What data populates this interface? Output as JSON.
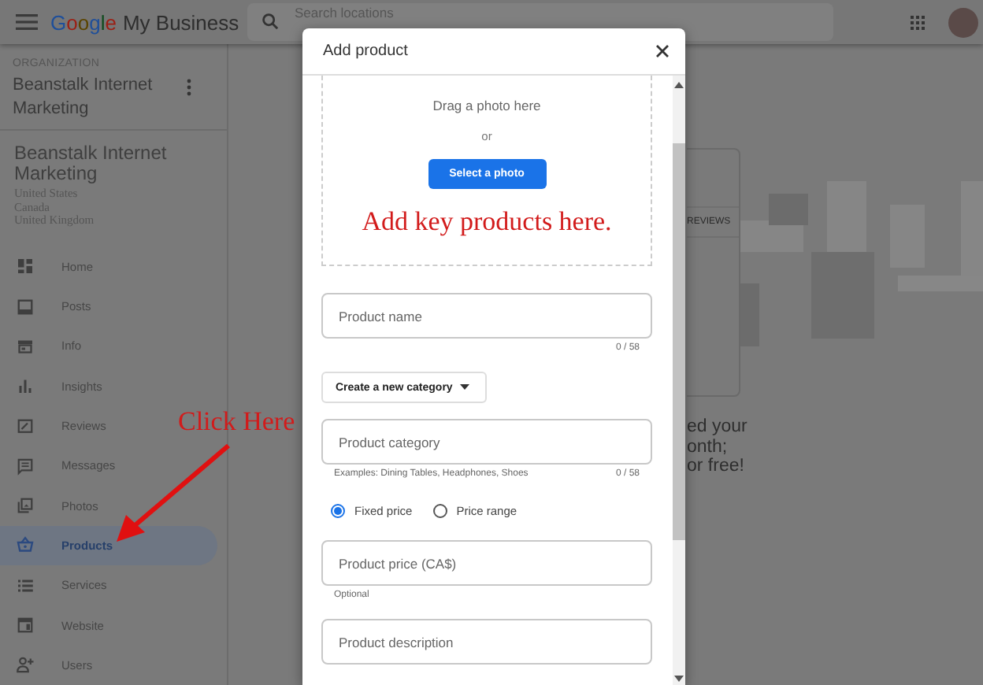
{
  "header": {
    "logo": {
      "brand": "Google",
      "product": "My Business"
    },
    "search": {
      "placeholder": "Search locations"
    }
  },
  "sidebar": {
    "organization": {
      "label": "ORGANIZATION",
      "name": "Beanstalk Internet Marketing"
    },
    "business": {
      "name": "Beanstalk Internet Marketing",
      "regions": [
        "United States",
        "Canada",
        "United Kingdom"
      ]
    },
    "items": [
      {
        "label": "Home",
        "selected": false
      },
      {
        "label": "Posts",
        "selected": false
      },
      {
        "label": "Info",
        "selected": false
      },
      {
        "label": "Insights",
        "selected": false
      },
      {
        "label": "Reviews",
        "selected": false
      },
      {
        "label": "Messages",
        "selected": false
      },
      {
        "label": "Photos",
        "selected": false
      },
      {
        "label": "Products",
        "selected": true
      },
      {
        "label": "Services",
        "selected": false
      },
      {
        "label": "Website",
        "selected": false
      },
      {
        "label": "Users",
        "selected": false
      }
    ]
  },
  "background": {
    "tab_label": "REVIEWS",
    "promo_lines": [
      "ed your",
      "onth;",
      "or free!"
    ]
  },
  "dialog": {
    "title": "Add product",
    "upload": {
      "hint": "Drag a photo here",
      "separator": "or",
      "button": "Select a photo"
    },
    "fields": [
      {
        "kind": "text",
        "placeholder": "Product name",
        "counter": "0 / 58"
      },
      {
        "kind": "dropdown",
        "label": "Create a new category"
      },
      {
        "kind": "text",
        "placeholder": "Product category",
        "helper": "Examples: Dining Tables, Headphones, Shoes",
        "counter": "0 / 58"
      },
      {
        "kind": "radios",
        "options": [
          {
            "label": "Fixed price",
            "selected": true
          },
          {
            "label": "Price range",
            "selected": false
          }
        ]
      },
      {
        "kind": "text",
        "placeholder": "Product price (CA$)",
        "helper": "Optional"
      },
      {
        "kind": "text",
        "placeholder": "Product description"
      }
    ]
  },
  "annotations": [
    {
      "kind": "note",
      "text": "Add key products here."
    },
    {
      "kind": "callout",
      "text": "Click Here"
    }
  ]
}
